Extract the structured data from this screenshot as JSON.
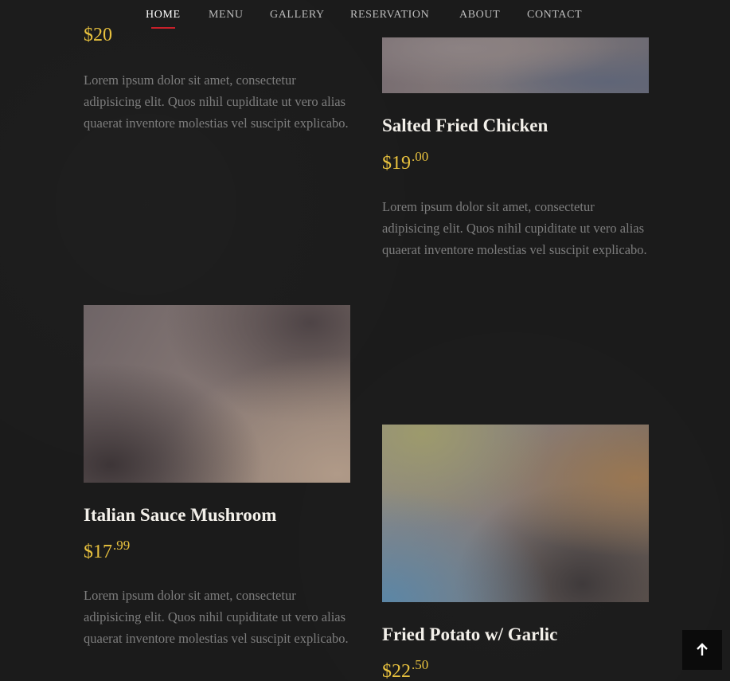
{
  "nav": {
    "items": [
      {
        "label": "HOME",
        "active": true
      },
      {
        "label": "MENU",
        "active": false
      },
      {
        "label": "GALLERY",
        "active": false
      },
      {
        "label": "RESERVATION",
        "active": false
      },
      {
        "label": "ABOUT",
        "active": false
      },
      {
        "label": "CONTACT",
        "active": false
      }
    ],
    "active_color": "#c8202a"
  },
  "dishes": {
    "top_left": {
      "price_dollars": "$20",
      "description": "Lorem ipsum dolor sit amet, consectetur adipisicing elit. Quos nihil cupiditate ut vero alias quaerat inventore molestias vel suscipit explicabo."
    },
    "salted_chicken": {
      "title": "Salted Fried Chicken",
      "price_dollars": "$19",
      "price_cents": ".00",
      "description": "Lorem ipsum dolor sit amet, consectetur adipisicing elit. Quos nihil cupiditate ut vero alias quaerat inventore molestias vel suscipit explicabo."
    },
    "italian_mushroom": {
      "title": "Italian Sauce Mushroom",
      "price_dollars": "$17",
      "price_cents": ".99",
      "description": "Lorem ipsum dolor sit amet, consectetur adipisicing elit. Quos nihil cupiditate ut vero alias quaerat inventore molestias vel suscipit explicabo."
    },
    "fried_potato": {
      "title": "Fried Potato w/ Garlic",
      "price_dollars": "$22",
      "price_cents": ".50"
    }
  },
  "back_to_top": {
    "icon": "arrow-up-icon"
  },
  "colors": {
    "background": "#1b1b1b",
    "price": "#e9c23e",
    "title": "#f3f0ea",
    "description": "#7d7d7d"
  }
}
